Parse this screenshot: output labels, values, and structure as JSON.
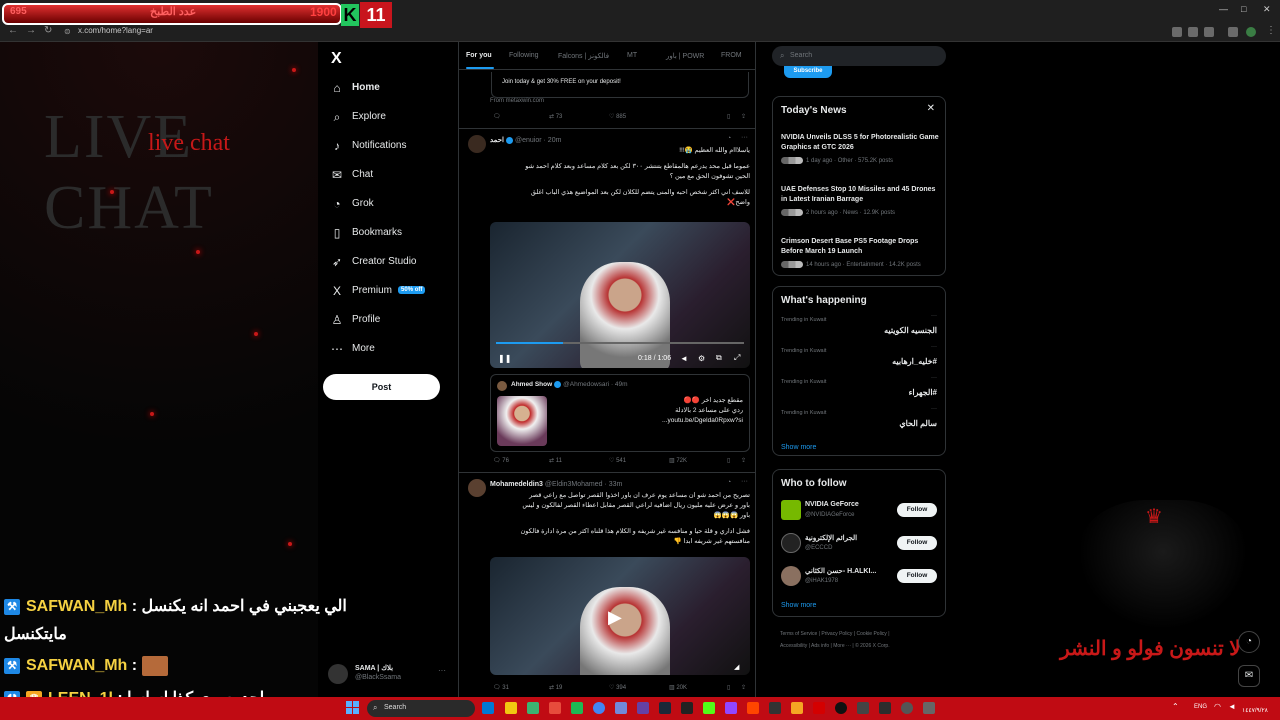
{
  "browser": {
    "url": "x.com/home?lang=ar",
    "window_controls": [
      "—",
      "□",
      "✕"
    ]
  },
  "overlay": {
    "hud_red_text": "695",
    "hud_label": "عدد الطبخ",
    "hud_number": "1900",
    "hud_k": "K",
    "hud_count": "11",
    "live_chat_big": "LIVE CHAT",
    "live_chat_small": "live chat",
    "watermark_text": "لا تنسون فولو و النشر",
    "chat": [
      {
        "user": "SAFWAN_Mh",
        "message": "الي يعجبني في احمد انه يكنسل",
        "continuation": "مايتكنسل"
      },
      {
        "user": "SAFWAN_Mh",
        "message": ""
      },
      {
        "user": "LEEN_1l",
        "message": "ماحد يسوي كذا اساسا"
      }
    ]
  },
  "sidebar": {
    "logo": "X",
    "items": [
      {
        "icon": "home-icon",
        "glyph": "⌂",
        "label": "Home"
      },
      {
        "icon": "explore-icon",
        "glyph": "⌕",
        "label": "Explore"
      },
      {
        "icon": "bell-icon",
        "glyph": "♪",
        "label": "Notifications"
      },
      {
        "icon": "chat-icon",
        "glyph": "✉",
        "label": "Chat"
      },
      {
        "icon": "grok-icon",
        "glyph": "◔",
        "label": "Grok"
      },
      {
        "icon": "bookmark-icon",
        "glyph": "▯",
        "label": "Bookmarks"
      },
      {
        "icon": "rocket-icon",
        "glyph": "➶",
        "label": "Creator Studio"
      },
      {
        "icon": "x-premium-icon",
        "glyph": "X",
        "label": "Premium",
        "badge": "50% off"
      },
      {
        "icon": "person-icon",
        "glyph": "♙",
        "label": "Profile"
      },
      {
        "icon": "more-circle-icon",
        "glyph": "⋯",
        "label": "More"
      }
    ],
    "post_button": "Post",
    "account": {
      "name": "SAMA | بلاك",
      "handle": "@BlackSsama",
      "more": "···"
    }
  },
  "timeline": {
    "tabs": [
      "For you",
      "Following",
      "Falcons | فالكونز",
      "MT",
      "باور | POWR",
      "FROM"
    ],
    "ad": {
      "text": "Join today & get 30% FREE on your deposit!",
      "from": "From metaxwin.com",
      "actions": {
        "reposts": "73",
        "likes": "885"
      }
    },
    "posts": [
      {
        "name": "احمد",
        "handle": "@enuior",
        "time": "· 20m",
        "lines": [
          "ياسلااام والله العظيم 😭!!!",
          "عموما قبل محد يدرعم هالمقاطع بتنتشر ٣٠٠ لكن بعد كلام مساعد وبعد كلام احمد شو",
          "الحين تشوفون الحق مع مين ؟",
          "للاسف اني اكثر شخص احبه والمنى يتضم للكلان لكن بعد المواضيع هذي الباب اغلق",
          "واضح❌"
        ],
        "video_time": "0:18 / 1:06",
        "video_progress": 0.27,
        "quote": {
          "name": "Ahmed Show",
          "handle": "@Ahmedowsari · 49m",
          "lines": [
            "مقطع جديد اخر 🔴🔴",
            "ردي على مساعد 2 بالادلة",
            "youtu.be/Dgelda0Rpxw?si..."
          ]
        },
        "actions": {
          "replies": "76",
          "reposts": "11",
          "likes": "541",
          "views": "72K"
        }
      },
      {
        "name": "Mohamedeldin3",
        "handle": "@Eldin3Mohamed · 33m",
        "lines": [
          "تصريح من احمد شو ان مساعد يوم عرف ان باور اخذوا القصر تواصل مع راعي قصر",
          "باور و عرض عليه مليون ريال اضافيه لراعي القصر مقابل اعطاء القصر لفالكون و ليس",
          "باور 😱😱😱",
          "فشل اداري و قلة حيا و منافسه غير شريفه و الكلام هذا قلناه اكثر من مرة ادارة فالكون",
          "منافستهم غير شريفه ابدا 👎"
        ],
        "actions": {
          "replies": "31",
          "reposts": "19",
          "likes": "394",
          "views": "20K"
        }
      }
    ]
  },
  "right": {
    "search_placeholder": "Search",
    "subscribe": "Subscribe",
    "news": {
      "title": "Today's News",
      "close": "✕",
      "items": [
        {
          "title": "NVIDIA Unveils DLSS 5 for Photorealistic Game Graphics at GTC 2026",
          "meta": "1 day ago · Other · 575.2K posts"
        },
        {
          "title": "UAE Defenses Stop 10 Missiles and 45 Drones in Latest Iranian Barrage",
          "meta": "2 hours ago · News · 12.9K posts"
        },
        {
          "title": "Crimson Desert Base PS5 Footage Drops Before March 19 Launch",
          "meta": "14 hours ago · Entertainment · 14.2K posts"
        }
      ]
    },
    "happening": {
      "title": "What's happening",
      "items": [
        {
          "cat": "Trending in Kuwait",
          "name": "الجنسيه الكويتيه"
        },
        {
          "cat": "Trending in Kuwait",
          "name": "#خليه_ارهابيه"
        },
        {
          "cat": "Trending in Kuwait",
          "name": "#الجهراء"
        },
        {
          "cat": "Trending in Kuwait",
          "name": "سالم الحاي"
        }
      ],
      "show_more": "Show more"
    },
    "follow": {
      "title": "Who to follow",
      "items": [
        {
          "name": "NVIDIA GeForce",
          "handle": "@NVIDIAGeForce",
          "button": "Follow"
        },
        {
          "name": "الجرائم الإلكترونية",
          "handle": "@ECCCD",
          "button": "Follow"
        },
        {
          "name": "حسن الكثاني- H.ALKI...",
          "handle": "@iHAK1978",
          "button": "Follow"
        }
      ],
      "show_more": "Show more"
    },
    "footer": [
      "Terms of Service",
      "Privacy Policy",
      "Cookie Policy",
      "Accessibility",
      "Ads info",
      "More ···",
      "© 2026 X Corp."
    ]
  },
  "taskbar": {
    "search": "Search",
    "lang": "ENG",
    "date": "١٤٤٧/٩/٢٨"
  }
}
